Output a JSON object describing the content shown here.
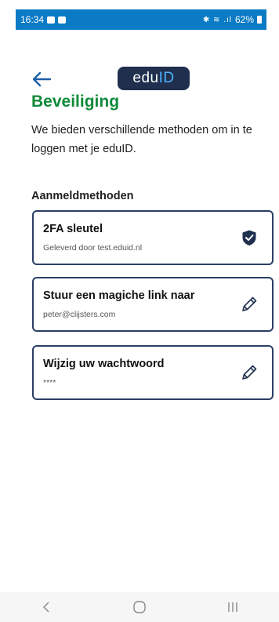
{
  "status_bar": {
    "time": "16:34",
    "right_indicator": "62%",
    "bg_color": "#0a7bc4"
  },
  "header": {
    "back_icon": "arrow-left-icon",
    "logo": {
      "text_main": "edu",
      "text_accent": "ID",
      "bg_color": "#1f2f4d",
      "accent_color": "#4db3ff"
    }
  },
  "page": {
    "title": "Beveiliging",
    "title_color": "#0f8a3a",
    "intro": "We bieden verschillende methoden om in te loggen met je eduID.",
    "section_title": "Aanmeldmethoden"
  },
  "methods": [
    {
      "title": "2FA sleutel",
      "subtitle": "Geleverd door test.eduid.nl",
      "icon": "shield-check-icon"
    },
    {
      "title": "Stuur een magiche link naar",
      "subtitle": "peter@clijsters.com",
      "icon": "pencil-icon"
    },
    {
      "title": "Wijzig uw wachtwoord",
      "subtitle": "****",
      "icon": "pencil-icon"
    }
  ],
  "nav_bar": {
    "back_icon": "chevron-left-icon",
    "home_icon": "home-circle-icon",
    "recents_icon": "recents-icon"
  },
  "colors": {
    "card_border": "#2a3f66",
    "back_arrow": "#1d5fa8"
  }
}
